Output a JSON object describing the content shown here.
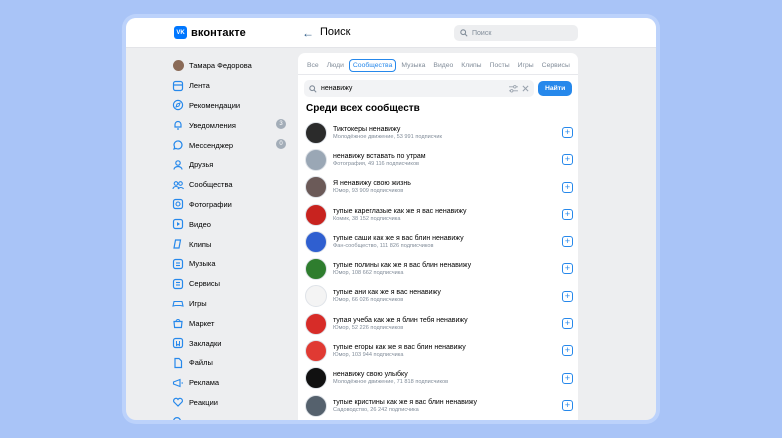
{
  "app": {
    "logo_mark": "VK",
    "logo_text": "вконтакте"
  },
  "header": {
    "back_label": "←",
    "title": "Поиск",
    "search_placeholder": "Поиск"
  },
  "sidebar": {
    "items": [
      {
        "icon": "avatar",
        "label": "Тамара Федорова"
      },
      {
        "icon": "feed-icon",
        "label": "Лента"
      },
      {
        "icon": "recommendations-icon",
        "label": "Рекомендации"
      },
      {
        "icon": "bell-icon",
        "label": "Уведомления",
        "badge": "3"
      },
      {
        "icon": "chat-icon",
        "label": "Мессенджер",
        "badge": "0"
      },
      {
        "icon": "friends-icon",
        "label": "Друзья"
      },
      {
        "icon": "communities-icon",
        "label": "Сообщества"
      },
      {
        "icon": "photo-icon",
        "label": "Фотографии"
      },
      {
        "icon": "video-icon",
        "label": "Видео"
      },
      {
        "icon": "clips-icon",
        "label": "Клипы"
      },
      {
        "icon": "music-icon",
        "label": "Музыка"
      },
      {
        "icon": "services-icon",
        "label": "Сервисы"
      },
      {
        "icon": "games-icon",
        "label": "Игры"
      },
      {
        "icon": "market-icon",
        "label": "Маркет"
      },
      {
        "icon": "bookmark-icon",
        "label": "Закладки"
      },
      {
        "icon": "files-icon",
        "label": "Файлы"
      },
      {
        "icon": "ads-icon",
        "label": "Реклама"
      },
      {
        "icon": "reactions-icon",
        "label": "Реакции"
      },
      {
        "icon": "search-icon",
        "label": "Поиск"
      }
    ]
  },
  "tabs": [
    "Все",
    "Люди",
    "Сообщества",
    "Музыка",
    "Видео",
    "Клипы",
    "Посты",
    "Игры",
    "Сервисы"
  ],
  "active_tab": "Сообщества",
  "search": {
    "value": "ненавижу",
    "button_label": "Найти"
  },
  "section_title": "Среди всех сообществ",
  "results": [
    {
      "name": "Тиктокеры ненавижу",
      "sub": "Молодёжное движение, 53 991 подписчик",
      "color": "#2b2b2b"
    },
    {
      "name": "ненавижу вставать по утрам",
      "sub": "Фотография, 49 116 подписчиков",
      "color": "#9aa7b5"
    },
    {
      "name": "Я ненавижу свою жизнь",
      "sub": "Юмор, 93 909 подписчиков",
      "color": "#6b5a58"
    },
    {
      "name": "тупые кареглазые как же я вас ненавижу",
      "sub": "Комик, 38 152 подписчика",
      "color": "#c8231f"
    },
    {
      "name": "тупые саши как же я вас блин ненавижу",
      "sub": "Фан-сообщество, 111 826 подписчиков",
      "color": "#2f5fd0"
    },
    {
      "name": "тупые полины как же я вас блин ненавижу",
      "sub": "Юмор, 108 662 подписчика",
      "color": "#2e7d2e"
    },
    {
      "name": "тупые ани как же я вас ненавижу",
      "sub": "Юмор, 66 026 подписчиков",
      "color": "#f4f4f4"
    },
    {
      "name": "тупая учеба как же я блин тебя ненавижу",
      "sub": "Юмор, 52 226 подписчиков",
      "color": "#d72c28"
    },
    {
      "name": "тупые егоры как же я вас блин ненавижу",
      "sub": "Юмор, 103 944 подписчика",
      "color": "#e03a33"
    },
    {
      "name": "ненавижу свою улыбку",
      "sub": "Молодёжное движение, 71 818 подписчиков",
      "color": "#111111"
    },
    {
      "name": "тупые кристины как же я вас блин ненавижу",
      "sub": "Садоводство, 26 242 подписчика",
      "color": "#55616d"
    }
  ]
}
